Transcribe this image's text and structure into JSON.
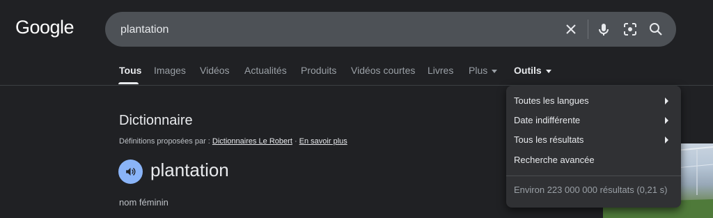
{
  "logo": "Google",
  "search": {
    "query": "plantation"
  },
  "tabs": {
    "all": "Tous",
    "images": "Images",
    "videos": "Vidéos",
    "news": "Actualités",
    "products": "Produits",
    "shorts": "Vidéos courtes",
    "books": "Livres",
    "more": "Plus",
    "tools": "Outils"
  },
  "dictionary": {
    "title": "Dictionnaire",
    "source_prefix": "Définitions proposées par :",
    "source_link": "Dictionnaires Le Robert",
    "separator": "·",
    "learn_more": "En savoir plus",
    "word": "plantation",
    "part_of_speech": "nom féminin"
  },
  "tools_menu": {
    "languages": "Toutes les langues",
    "date": "Date indifférente",
    "results": "Tous les résultats",
    "advanced": "Recherche avancée",
    "stats": "Environ 223 000 000 résultats (0,21 s)"
  },
  "colors": {
    "background": "#202124",
    "searchbox": "#4d5156",
    "menu": "#303134",
    "speaker": "#8ab4f8"
  }
}
